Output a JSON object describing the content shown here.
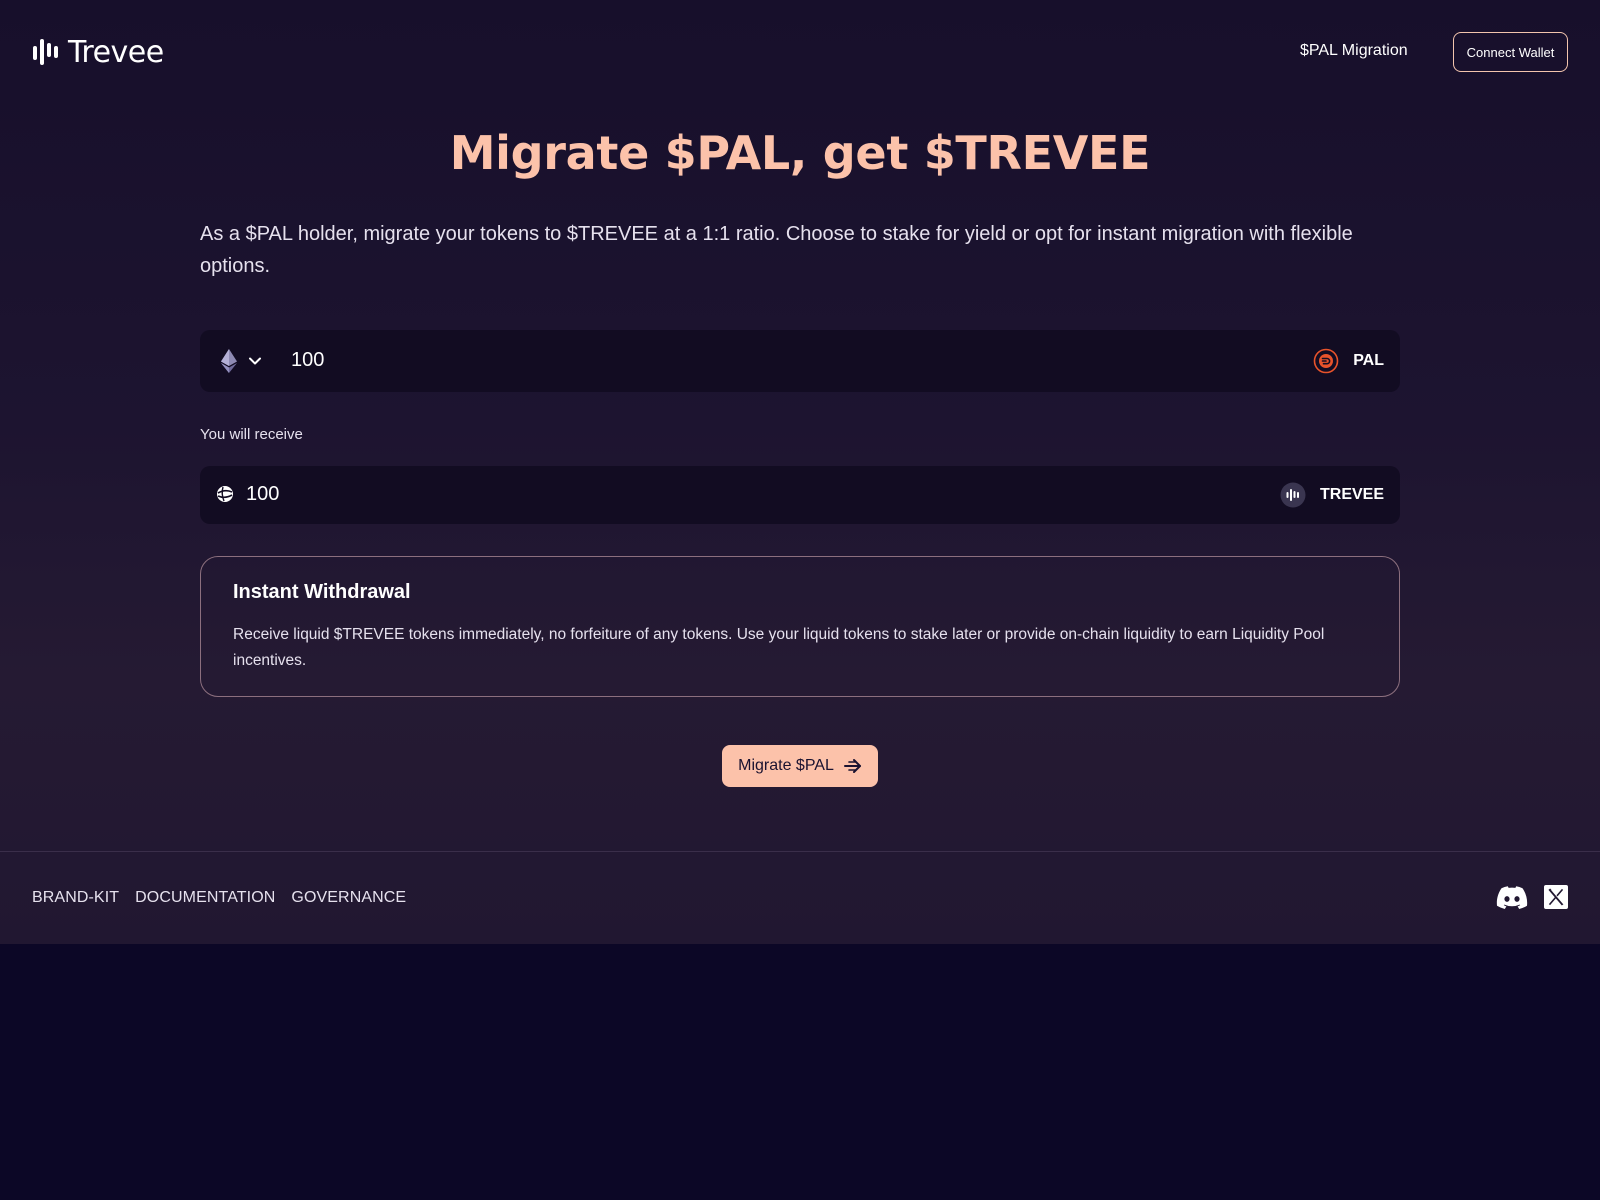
{
  "header": {
    "logo_text": "Trevee",
    "nav_link": "$PAL Migration",
    "connect_label": "Connect Wallet"
  },
  "hero": {
    "title": "Migrate $PAL, get $TREVEE",
    "subtitle": "As a $PAL holder, migrate your tokens to $TREVEE at a 1:1 ratio. Choose to stake for yield or opt for instant migration with flexible options."
  },
  "from_field": {
    "chain_icon": "ethereum-icon",
    "amount": "100",
    "token_icon": "pal-token-icon",
    "token_symbol": "PAL"
  },
  "receive": {
    "label": "You will receive",
    "chain_icon": "sonic-icon",
    "amount": "100",
    "token_icon": "trevee-token-icon",
    "token_symbol": "TREVEE"
  },
  "option_card": {
    "title": "Instant Withdrawal",
    "description": "Receive liquid $TREVEE tokens immediately, no forfeiture of any tokens. Use your liquid tokens to stake later or provide on-chain liquidity to earn Liquidity Pool incentives."
  },
  "migrate_button": {
    "label": "Migrate $PAL",
    "icon": "arrow-right-icon"
  },
  "footer": {
    "links": [
      "BRAND-KIT",
      "DOCUMENTATION",
      "GOVERNANCE"
    ],
    "social_icons": [
      "discord-icon",
      "x-icon"
    ]
  },
  "colors": {
    "accent": "#fcc2aa",
    "background": "#0c0726",
    "field_background": "#120c22",
    "pal_orange": "#e8532b"
  }
}
